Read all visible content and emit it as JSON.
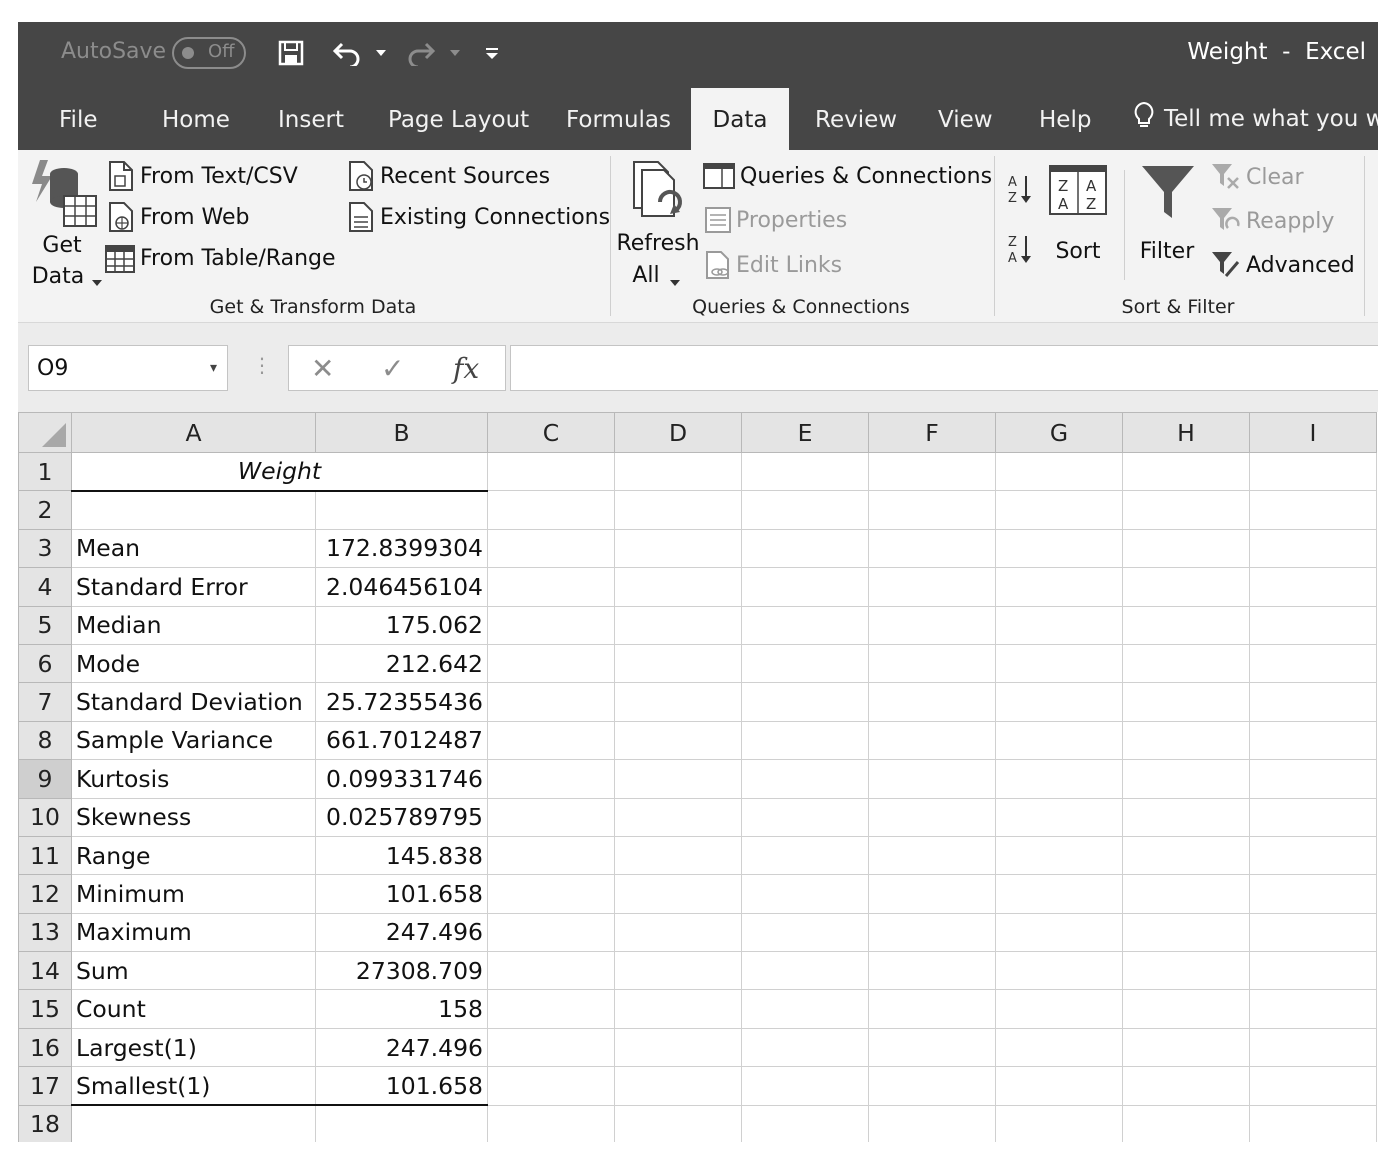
{
  "titlebar": {
    "autosave_label": "AutoSave",
    "autosave_state": "Off",
    "doc_title": "Weight  -  Excel"
  },
  "tabs": [
    "File",
    "Home",
    "Insert",
    "Page Layout",
    "Formulas",
    "Data",
    "Review",
    "View",
    "Help"
  ],
  "active_tab": "Data",
  "tell_me": "Tell me what you wa",
  "ribbon": {
    "get_data": {
      "line1": "Get",
      "line2": "Data"
    },
    "from_text_csv": "From Text/CSV",
    "from_web": "From Web",
    "from_table_range": "From Table/Range",
    "recent_sources": "Recent Sources",
    "existing_connections": "Existing Connections",
    "group_get_transform": "Get & Transform Data",
    "refresh_all": {
      "line1": "Refresh",
      "line2": "All"
    },
    "queries_connections": "Queries & Connections",
    "properties": "Properties",
    "edit_links": "Edit Links",
    "group_queries": "Queries & Connections",
    "sort": "Sort",
    "filter": "Filter",
    "clear": "Clear",
    "reapply": "Reapply",
    "advanced": "Advanced",
    "group_sort_filter": "Sort & Filter"
  },
  "formula_bar": {
    "name_box": "O9",
    "formula": "",
    "fx": "fx"
  },
  "columns": [
    "A",
    "B",
    "C",
    "D",
    "E",
    "F",
    "G",
    "H",
    "I"
  ],
  "sheet": {
    "title": "Weight",
    "rows": [
      {
        "label": "Mean",
        "value": "172.8399304"
      },
      {
        "label": "Standard Error",
        "value": "2.046456104"
      },
      {
        "label": "Median",
        "value": "175.062"
      },
      {
        "label": "Mode",
        "value": "212.642"
      },
      {
        "label": "Standard Deviation",
        "value": "25.72355436"
      },
      {
        "label": "Sample Variance",
        "value": "661.7012487"
      },
      {
        "label": "Kurtosis",
        "value": "0.099331746"
      },
      {
        "label": "Skewness",
        "value": "0.025789795"
      },
      {
        "label": "Range",
        "value": "145.838"
      },
      {
        "label": "Minimum",
        "value": "101.658"
      },
      {
        "label": "Maximum",
        "value": "247.496"
      },
      {
        "label": "Sum",
        "value": "27308.709"
      },
      {
        "label": "Count",
        "value": "158"
      },
      {
        "label": "Largest(1)",
        "value": "247.496"
      },
      {
        "label": "Smallest(1)",
        "value": "101.658"
      }
    ],
    "row_numbers": [
      "1",
      "2",
      "3",
      "4",
      "5",
      "6",
      "7",
      "8",
      "9",
      "10",
      "11",
      "12",
      "13",
      "14",
      "15",
      "16",
      "17",
      "18"
    ],
    "selected_row": "9"
  },
  "colors": {
    "titlebar": "#464646",
    "ribbon": "#f3f3f3",
    "header": "#e4e4e4",
    "selected_header": "#cfcfcf"
  }
}
